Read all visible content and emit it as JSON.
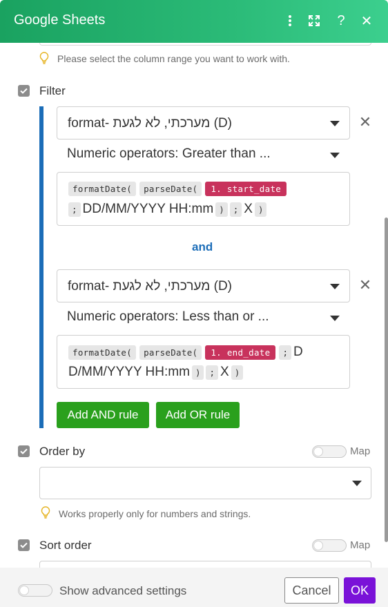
{
  "header": {
    "title": "Google Sheets"
  },
  "range_hint": "Please select the column range you want to work with.",
  "filter": {
    "label": "Filter",
    "and_label": "and",
    "rules": [
      {
        "column": "format- מערכתי, לא לגעת (D)",
        "operator": "Numeric operators: Greater than ...",
        "expr_line1": {
          "fn1": "formatDate(",
          "fn2": "parseDate(",
          "token": "1. start_date"
        },
        "expr_line2": {
          "sep1": ";",
          "text": "DD/MM/YYYY HH:mm",
          "paren1": ")",
          "sep2": ";",
          "x": "X",
          "paren2": ")"
        }
      },
      {
        "column": "format- מערכתי, לא לגעת (D)",
        "operator": "Numeric operators: Less than or ...",
        "expr_line1": {
          "fn1": "formatDate(",
          "fn2": "parseDate(",
          "token": "1. end_date",
          "sep1": ";",
          "text_start": "D"
        },
        "expr_line2": {
          "text_rest": "D/MM/YYYY HH:mm",
          "paren1": ")",
          "sep2": ";",
          "x": "X",
          "paren2": ")"
        }
      }
    ],
    "add_and_label": "Add AND rule",
    "add_or_label": "Add OR rule"
  },
  "order_by": {
    "label": "Order by",
    "map_label": "Map",
    "hint": "Works properly only for numbers and strings."
  },
  "sort_order": {
    "label": "Sort order",
    "map_label": "Map"
  },
  "footer": {
    "advanced_label": "Show advanced settings",
    "cancel_label": "Cancel",
    "ok_label": "OK"
  },
  "colors": {
    "header_green": "#1aa260",
    "filter_blue": "#1b6db8",
    "token_pink": "#c8325c",
    "button_green": "#2aa01d",
    "ok_purple": "#7a12d8"
  }
}
